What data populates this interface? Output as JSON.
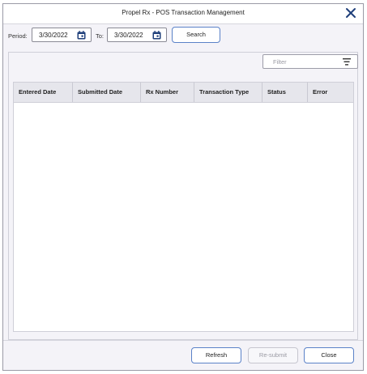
{
  "window": {
    "title": "Propel Rx - POS Transaction Management"
  },
  "toolbar": {
    "period_label": "Period:",
    "from_date": "3/30/2022",
    "to_label": "To:",
    "to_date": "3/30/2022",
    "search_label": "Search"
  },
  "filter": {
    "placeholder": "Filter"
  },
  "table": {
    "columns": [
      "Entered Date",
      "Submitted Date",
      "Rx Number",
      "Transaction Type",
      "Status",
      "Error"
    ],
    "rows": []
  },
  "footer": {
    "refresh_label": "Refresh",
    "resubmit_label": "Re-submit",
    "close_label": "Close"
  },
  "colors": {
    "accent": "#1f3f7a",
    "button_border": "#5b82c8"
  },
  "icons": {
    "close": "close-icon",
    "calendar": "calendar-icon",
    "filter": "filter-icon"
  }
}
